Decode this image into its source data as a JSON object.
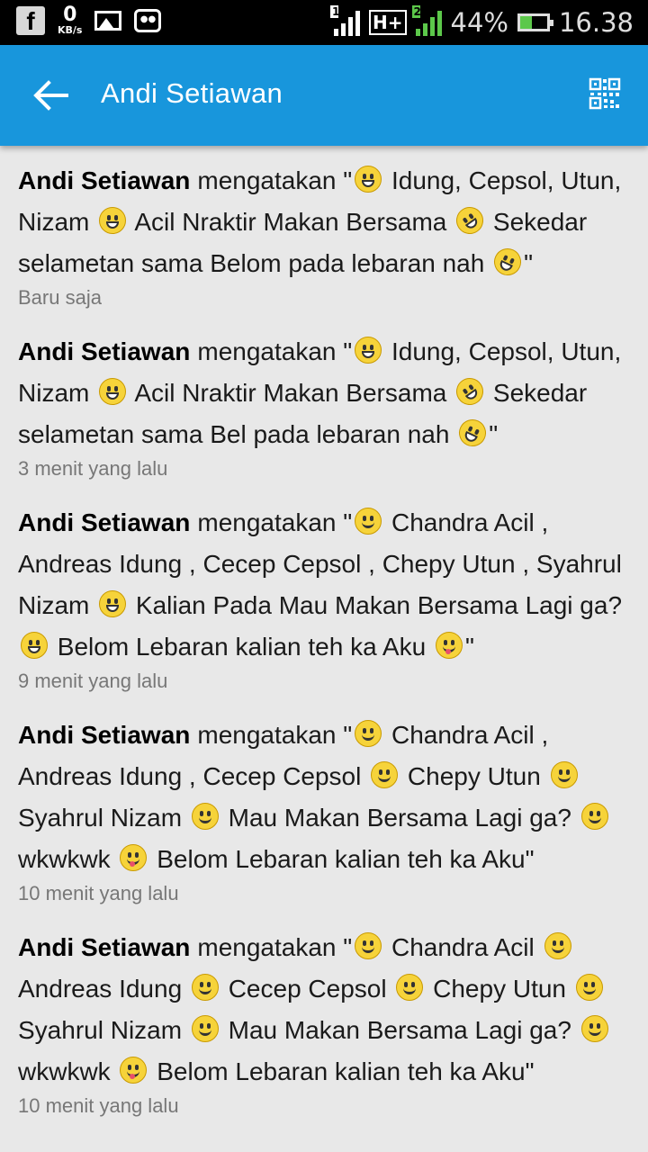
{
  "status_bar": {
    "net_speed_value": "0",
    "net_speed_unit": "KB/s",
    "sim1_label": "1",
    "network_type": "H+",
    "sim2_label": "2",
    "battery_percent": "44%",
    "battery_level": 0.44,
    "time": "16.38",
    "icons": [
      "facebook-icon",
      "gallery-icon",
      "bbm-icon",
      "signal-icon",
      "charging-battery-icon"
    ]
  },
  "app_bar": {
    "title": "Andi Setiawan",
    "back_icon": "arrow-left-icon",
    "action_icon": "qr-code-icon",
    "color": "#1896dc"
  },
  "feed": [
    {
      "name": "Andi Setiawan",
      "verb": "mengatakan",
      "parts": [
        {
          "t": " \""
        },
        {
          "e": "grin"
        },
        {
          "t": " Idung, Cepsol, Utun, Nizam "
        },
        {
          "e": "grin"
        },
        {
          "t": " Acil Nraktir Makan Bersama "
        },
        {
          "e": "laugh"
        },
        {
          "t": " Sekedar selametan sama Belom pada lebaran nah "
        },
        {
          "e": "rofl"
        },
        {
          "t": "\""
        }
      ],
      "time": "Baru saja"
    },
    {
      "name": "Andi Setiawan",
      "verb": "mengatakan",
      "parts": [
        {
          "t": " \""
        },
        {
          "e": "grin"
        },
        {
          "t": " Idung, Cepsol, Utun, Nizam "
        },
        {
          "e": "grin"
        },
        {
          "t": " Acil Nraktir Makan Bersama "
        },
        {
          "e": "laugh"
        },
        {
          "t": " Sekedar selametan sama Bel pada lebaran nah "
        },
        {
          "e": "rofl"
        },
        {
          "t": "\""
        }
      ],
      "time": "3 menit yang lalu"
    },
    {
      "name": "Andi Setiawan",
      "verb": "mengatakan",
      "parts": [
        {
          "t": " \""
        },
        {
          "e": "smile"
        },
        {
          "t": " Chandra Acil , Andreas Idung , Cecep Cepsol , Chepy Utun , Syahrul Nizam "
        },
        {
          "e": "grin"
        },
        {
          "t": " Kalian Pada Mau Makan Bersama Lagi ga? "
        },
        {
          "e": "grin"
        },
        {
          "t": " Belom Lebaran kalian teh ka Aku "
        },
        {
          "e": "tongue"
        },
        {
          "t": "\""
        }
      ],
      "time": "9 menit yang lalu"
    },
    {
      "name": "Andi Setiawan",
      "verb": "mengatakan",
      "parts": [
        {
          "t": " \""
        },
        {
          "e": "smile"
        },
        {
          "t": " Chandra Acil , Andreas Idung , Cecep Cepsol "
        },
        {
          "e": "smile"
        },
        {
          "t": " Chepy Utun "
        },
        {
          "e": "smile"
        },
        {
          "t": " Syahrul Nizam "
        },
        {
          "e": "smile"
        },
        {
          "t": " Mau Makan Bersama Lagi ga? "
        },
        {
          "e": "smile"
        },
        {
          "t": " wkwkwk "
        },
        {
          "e": "tongue"
        },
        {
          "t": " Belom Lebaran kalian teh ka Aku\""
        }
      ],
      "time": "10 menit yang lalu"
    },
    {
      "name": "Andi Setiawan",
      "verb": "mengatakan",
      "parts": [
        {
          "t": " \""
        },
        {
          "e": "smile"
        },
        {
          "t": " Chandra Acil "
        },
        {
          "e": "smile"
        },
        {
          "t": " Andreas Idung "
        },
        {
          "e": "smile"
        },
        {
          "t": " Cecep Cepsol "
        },
        {
          "e": "smile"
        },
        {
          "t": " Chepy Utun "
        },
        {
          "e": "smile"
        },
        {
          "t": " Syahrul Nizam "
        },
        {
          "e": "smile"
        },
        {
          "t": " Mau Makan Bersama Lagi ga? "
        },
        {
          "e": "smile"
        },
        {
          "t": " wkwkwk "
        },
        {
          "e": "tongue"
        },
        {
          "t": " Belom Lebaran kalian teh ka Aku\""
        }
      ],
      "time": "10 menit yang lalu"
    }
  ]
}
